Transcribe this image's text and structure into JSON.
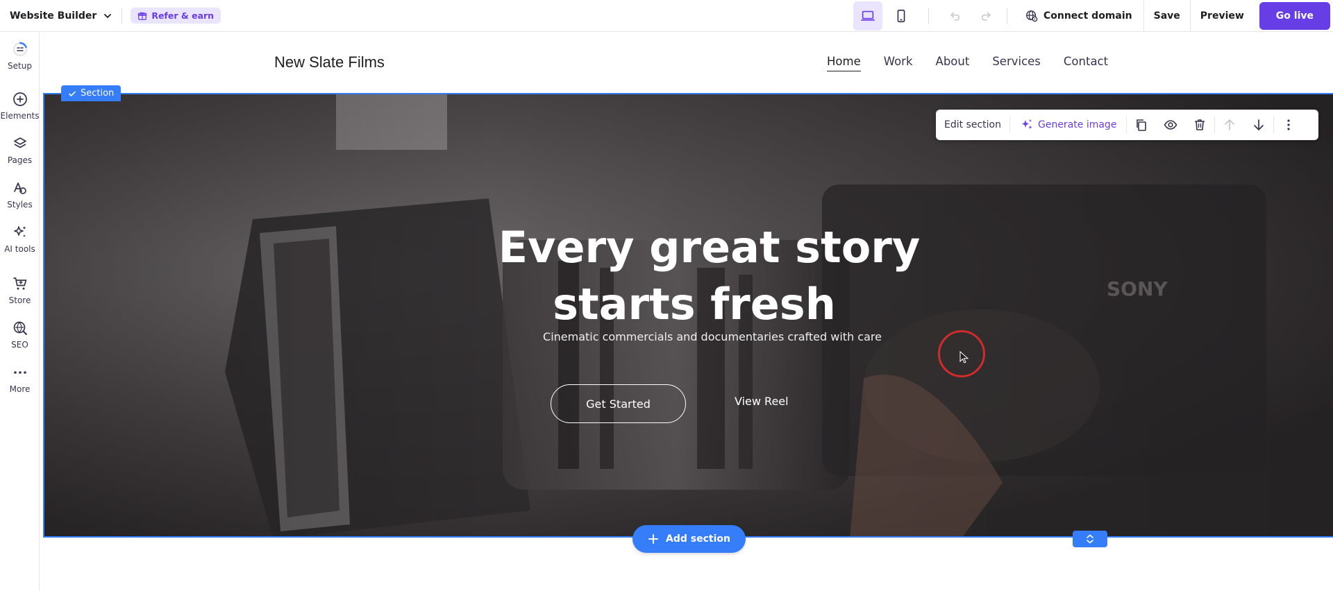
{
  "topbar": {
    "app_name": "Website Builder",
    "refer_label": "Refer & earn",
    "connect_domain": "Connect domain",
    "save": "Save",
    "preview": "Preview",
    "go_live": "Go live"
  },
  "sidebar": {
    "items": [
      {
        "label": "Setup",
        "icon": "setup-icon"
      },
      {
        "label": "Elements",
        "icon": "plus-circle-icon"
      },
      {
        "label": "Pages",
        "icon": "layers-icon"
      },
      {
        "label": "Styles",
        "icon": "styles-icon"
      },
      {
        "label": "AI tools",
        "icon": "sparkles-icon"
      },
      {
        "label": "Store",
        "icon": "cart-icon"
      },
      {
        "label": "SEO",
        "icon": "seo-icon"
      },
      {
        "label": "More",
        "icon": "more-icon"
      }
    ]
  },
  "site": {
    "logo": "New Slate Films",
    "nav": [
      "Home",
      "Work",
      "About",
      "Services",
      "Contact"
    ],
    "active_nav": "Home"
  },
  "hero": {
    "section_tag": "Section",
    "title_line1": "Every great story",
    "title_line2": "starts fresh",
    "subtitle": "Cinematic commercials and documentaries crafted with care",
    "primary_button": "Get Started",
    "secondary_button": "View Reel"
  },
  "section_toolbar": {
    "edit_section": "Edit section",
    "generate_image": "Generate image"
  },
  "canvas": {
    "add_section": "Add section"
  },
  "colors": {
    "accent": "#673de6",
    "selection_blue": "#357df9",
    "cursor_ring": "#d12b2b"
  }
}
